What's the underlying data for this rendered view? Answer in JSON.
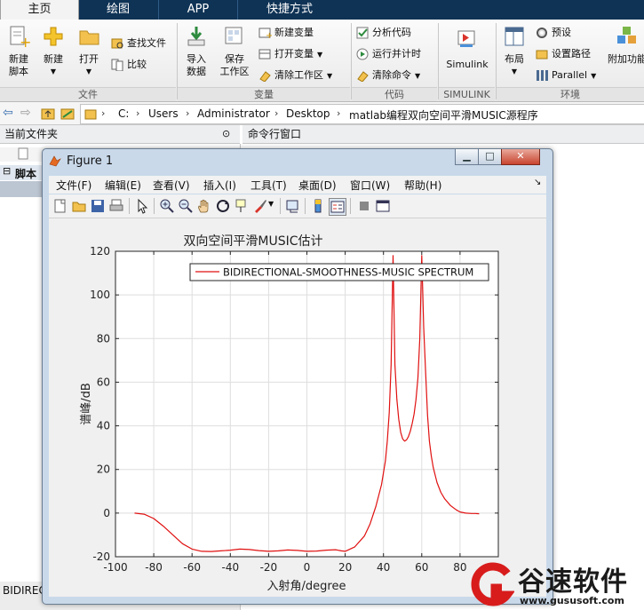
{
  "ribbon_tabs": [
    "主页",
    "绘图",
    "APP",
    "快捷方式"
  ],
  "ribbon": {
    "file": {
      "new_script": "新建\n脚本",
      "new": "新建",
      "open": "打开",
      "find_files": "查找文件",
      "compare": "比较",
      "group": "文件"
    },
    "variable": {
      "import": "导入\n数据",
      "save_ws": "保存\n工作区",
      "new_var": "新建变量",
      "open_var": "打开变量",
      "clear_ws": "清除工作区",
      "group": "变量"
    },
    "code": {
      "analyze": "分析代码",
      "run_time": "运行并计时",
      "clear_cmds": "清除命令",
      "group": "代码"
    },
    "simulink": {
      "label": "Simulink",
      "group": "SIMULINK"
    },
    "env": {
      "layout": "布局",
      "prefs": "预设",
      "set_path": "设置路径",
      "parallel": "Parallel",
      "addons": "附加功能",
      "group": "环境"
    }
  },
  "address": [
    "C:",
    "Users",
    "Administrator",
    "Desktop",
    "matlab编程双向空间平滑MUSIC源程序"
  ],
  "left_panel": {
    "title": "当前文件夹",
    "tree_label": "脚本",
    "bottom_text": "BIDIREC"
  },
  "command_window": {
    "title": "命令行窗口"
  },
  "figure": {
    "title": "Figure 1",
    "menus": [
      "文件(F)",
      "编辑(E)",
      "查看(V)",
      "插入(I)",
      "工具(T)",
      "桌面(D)",
      "窗口(W)",
      "帮助(H)"
    ]
  },
  "watermark": {
    "brand": "谷速软件",
    "url": "www.gususoft.com"
  },
  "chart_data": {
    "type": "line",
    "title": "双向空间平滑MUSIC估计",
    "xlabel": "入射角/degree",
    "ylabel": "谱峰/dB",
    "xlim": [
      -100,
      100
    ],
    "ylim": [
      -20,
      120
    ],
    "xticks": [
      -100,
      -80,
      -60,
      -40,
      -20,
      0,
      20,
      40,
      60,
      80
    ],
    "yticks": [
      -20,
      0,
      20,
      40,
      60,
      80,
      100,
      120
    ],
    "grid": true,
    "legend_position": "top-right",
    "series": [
      {
        "name": "BIDIRECTIONAL-SMOOTHNESS-MUSIC SPECTRUM",
        "color": "#e01010",
        "x": [
          -90,
          -85,
          -80,
          -75,
          -70,
          -65,
          -60,
          -55,
          -50,
          -45,
          -40,
          -35,
          -30,
          -25,
          -20,
          -15,
          -10,
          -5,
          0,
          5,
          10,
          15,
          18,
          20,
          25,
          30,
          33,
          36,
          39,
          41,
          42,
          43,
          44,
          45,
          46,
          47,
          48,
          49,
          50,
          51,
          52,
          53,
          54,
          55,
          56,
          57,
          58,
          59,
          60,
          61,
          62,
          63,
          64,
          65,
          66,
          68,
          70,
          72,
          75,
          78,
          80,
          83,
          86,
          88,
          90
        ],
        "y": [
          0,
          -0.5,
          -2.5,
          -6,
          -10,
          -14,
          -16.5,
          -17.5,
          -17.6,
          -17.3,
          -17,
          -16.5,
          -16.7,
          -17.2,
          -17.5,
          -17.3,
          -16.9,
          -17.1,
          -17.5,
          -17.4,
          -17,
          -16.8,
          -17.3,
          -17.5,
          -15.5,
          -10.5,
          -5,
          3,
          13,
          24,
          33,
          46,
          68,
          118,
          68,
          52,
          43,
          37,
          34,
          33,
          33.5,
          35,
          37.5,
          41,
          45.5,
          52,
          62,
          80,
          118,
          85,
          65,
          45,
          33,
          26,
          21,
          14,
          9.5,
          6.5,
          3.5,
          1.5,
          0.5,
          0,
          -0.2,
          -0.2,
          -0.3
        ]
      }
    ]
  }
}
